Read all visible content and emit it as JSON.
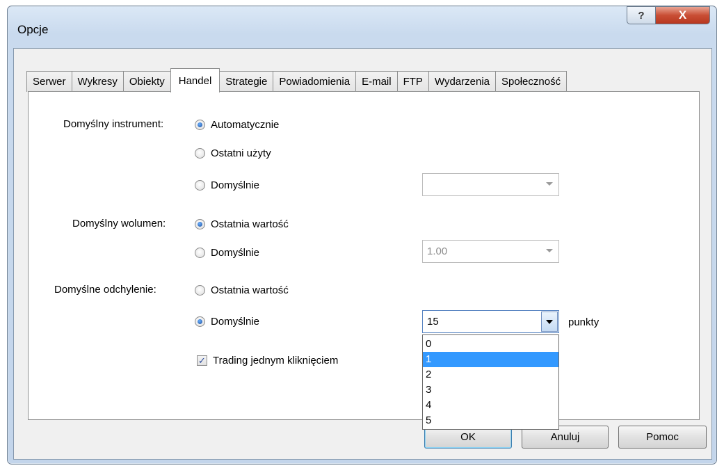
{
  "window": {
    "title": "Opcje",
    "help_label": "?",
    "close_label": "X"
  },
  "tabs": [
    {
      "label": "Serwer"
    },
    {
      "label": "Wykresy"
    },
    {
      "label": "Obiekty"
    },
    {
      "label": "Handel",
      "active": true
    },
    {
      "label": "Strategie"
    },
    {
      "label": "Powiadomienia"
    },
    {
      "label": "E-mail"
    },
    {
      "label": "FTP"
    },
    {
      "label": "Wydarzenia"
    },
    {
      "label": "Społeczność"
    }
  ],
  "instrument": {
    "label": "Domyślny instrument:",
    "options": [
      "Automatycznie",
      "Ostatni użyty",
      "Domyślnie"
    ],
    "selected": "Automatycznie",
    "combo_value": ""
  },
  "volume": {
    "label": "Domyślny wolumen:",
    "options": [
      "Ostatnia wartość",
      "Domyślnie"
    ],
    "selected": "Ostatnia wartość",
    "combo_value": "1.00"
  },
  "deviation": {
    "label": "Domyślne odchylenie:",
    "options": [
      "Ostatnia wartość",
      "Domyślnie"
    ],
    "selected": "Domyślnie",
    "combo_value": "15",
    "unit": "punkty",
    "dropdown_items": [
      "0",
      "1",
      "2",
      "3",
      "4",
      "5"
    ],
    "highlighted_item": "1"
  },
  "one_click": {
    "label": "Trading jednym kliknięciem",
    "checked": true,
    "check_glyph": "✓"
  },
  "buttons": {
    "ok": "OK",
    "cancel": "Anuluj",
    "help": "Pomoc"
  },
  "icons": {
    "help": "question-icon",
    "close": "close-icon",
    "dropdown": "chevron-down-icon"
  }
}
